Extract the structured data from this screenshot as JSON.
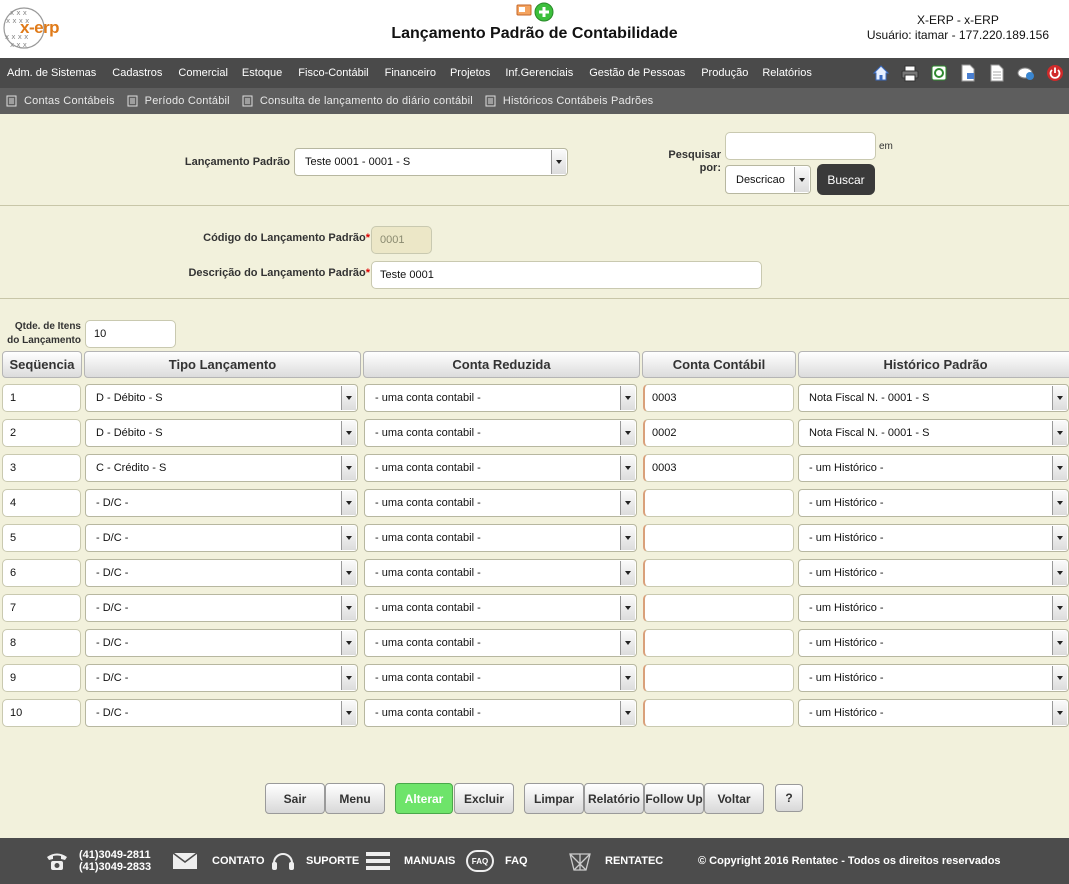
{
  "header": {
    "logo_text": "x-erp",
    "title": "Lançamento Padrão de Contabilidade",
    "system_name": "X-ERP - x-ERP",
    "user_info": "Usuário: itamar - 177.220.189.156"
  },
  "main_menu": [
    "Adm. de Sistemas",
    "Cadastros",
    "Comercial",
    "Estoque",
    "Fisco-Contábil",
    "Financeiro",
    "Projetos",
    "Inf.Gerenciais",
    "Gestão de Pessoas",
    "Produção",
    "Relatórios"
  ],
  "main_menu_icons": [
    "home-icon",
    "printer-icon",
    "recycle-icon",
    "document-icon",
    "page-icon",
    "chat-icon",
    "power-icon"
  ],
  "sub_menu": [
    "Contas Contábeis",
    "Período Contábil",
    "Consulta de lançamento do diário contábil",
    "Históricos Contábeis Padrões"
  ],
  "search": {
    "lancamento_label": "Lançamento Padrão",
    "lancamento_value": "Teste 0001 - 0001 - S",
    "pesquisar_label": "Pesquisar",
    "por_label": "por:",
    "em_label": "em",
    "search_value": "",
    "field_value": "Descricao",
    "button_label": "Buscar"
  },
  "form": {
    "codigo_label": "Código do Lançamento Padrão",
    "codigo_value": "0001",
    "descricao_label": "Descrição do Lançamento Padrão",
    "descricao_value": "Teste 0001",
    "required_mark": "*",
    "qtd_label_1": "Qtde. de Itens",
    "qtd_label_2": "do Lançamento",
    "qtd_value": "10"
  },
  "grid": {
    "headers": [
      "Seqüencia",
      "Tipo Lançamento",
      "Conta Reduzida",
      "Conta Contábil",
      "Histórico Padrão"
    ],
    "rows": [
      {
        "seq": "1",
        "tipo": "D - Débito - S",
        "reduzida": "- uma conta contabil -",
        "contabil": "0003",
        "historico": "Nota Fiscal N. - 0001 - S"
      },
      {
        "seq": "2",
        "tipo": "D - Débito - S",
        "reduzida": "- uma conta contabil -",
        "contabil": "0002",
        "historico": "Nota Fiscal N. - 0001 - S"
      },
      {
        "seq": "3",
        "tipo": "C - Crédito - S",
        "reduzida": "- uma conta contabil -",
        "contabil": "0003",
        "historico": "- um Histórico -"
      },
      {
        "seq": "4",
        "tipo": "- D/C -",
        "reduzida": "- uma conta contabil -",
        "contabil": "",
        "historico": "- um Histórico -"
      },
      {
        "seq": "5",
        "tipo": "- D/C -",
        "reduzida": "- uma conta contabil -",
        "contabil": "",
        "historico": "- um Histórico -"
      },
      {
        "seq": "6",
        "tipo": "- D/C -",
        "reduzida": "- uma conta contabil -",
        "contabil": "",
        "historico": "- um Histórico -"
      },
      {
        "seq": "7",
        "tipo": "- D/C -",
        "reduzida": "- uma conta contabil -",
        "contabil": "",
        "historico": "- um Histórico -"
      },
      {
        "seq": "8",
        "tipo": "- D/C -",
        "reduzida": "- uma conta contabil -",
        "contabil": "",
        "historico": "- um Histórico -"
      },
      {
        "seq": "9",
        "tipo": "- D/C -",
        "reduzida": "- uma conta contabil -",
        "contabil": "",
        "historico": "- um Histórico -"
      },
      {
        "seq": "10",
        "tipo": "- D/C -",
        "reduzida": "- uma conta contabil -",
        "contabil": "",
        "historico": "- um Histórico -"
      }
    ]
  },
  "actions": [
    "Sair",
    "Menu",
    "Alterar",
    "Excluir",
    "Limpar",
    "Relatório",
    "Follow Up",
    "Voltar",
    "?"
  ],
  "footer": {
    "phone_1": "(41)3049-2811",
    "phone_2": "(41)3049-2833",
    "contato": "CONTATO",
    "suporte": "SUPORTE",
    "manuais": "MANUAIS",
    "faq_badge": "FAQ",
    "faq": "FAQ",
    "rentatec": "RENTATEC",
    "copyright": "© Copyright 2016 Rentatec - Todos os direitos reservados"
  },
  "colors": {
    "background": "#f2f1dc",
    "menu_bar": "#4a4a4a",
    "sub_menu_bar": "#5e5e5e",
    "footer": "#4c4c4c",
    "active_button": "#6ee46a",
    "logo_accent": "#e07b1a"
  }
}
